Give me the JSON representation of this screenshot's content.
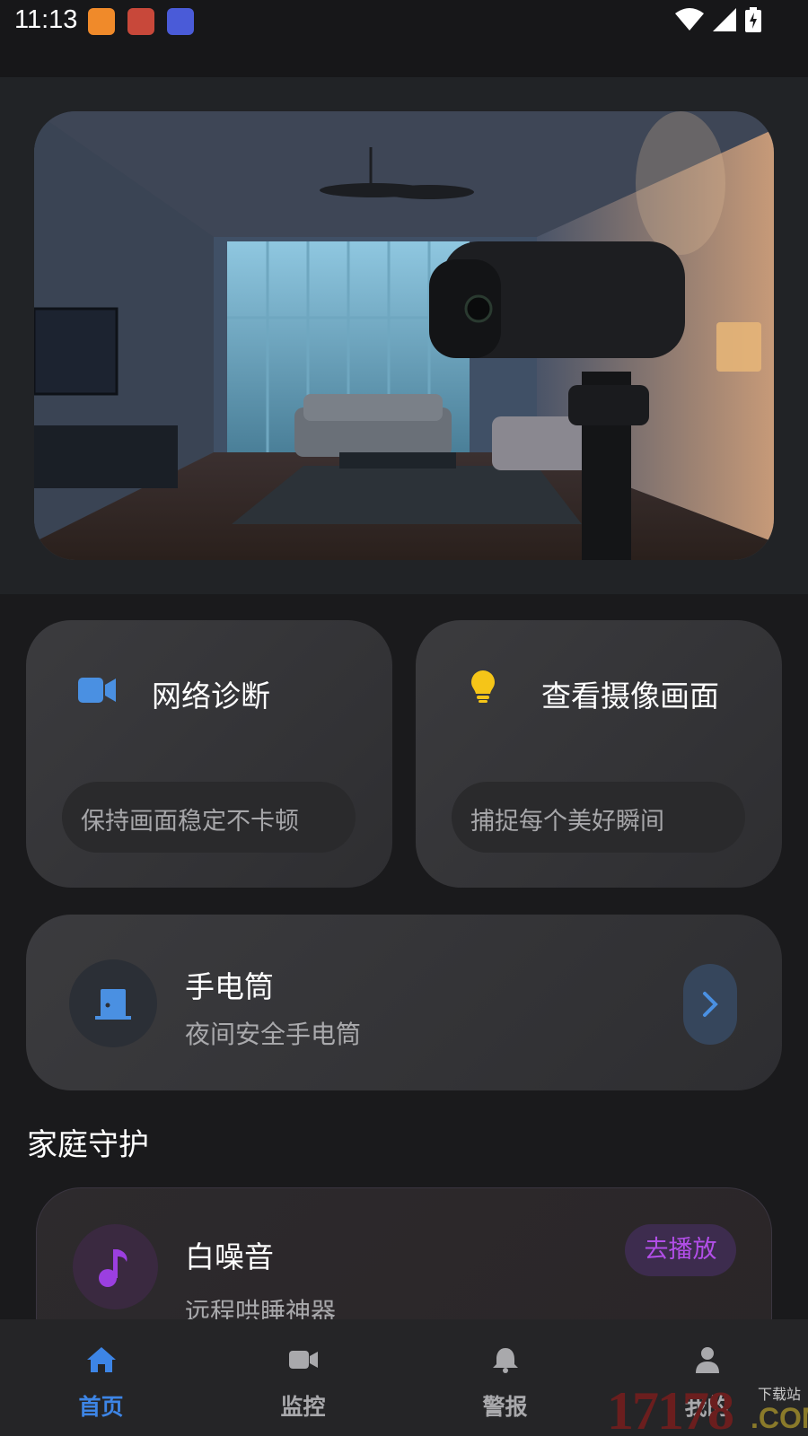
{
  "status_bar": {
    "time": "11:13",
    "icons": [
      "wifi-icon",
      "signal-icon",
      "battery-charging-icon"
    ]
  },
  "hero": {
    "image": "living-room-security-camera-photo"
  },
  "quick_cards": [
    {
      "title": "网络诊断",
      "subtitle": "保持画面稳定不卡顿",
      "icon": "video-camera-icon",
      "icon_color": "#4a90e2"
    },
    {
      "title": "查看摄像画面",
      "subtitle": "捕捉每个美好瞬间",
      "icon": "lightbulb-icon",
      "icon_color": "#f5c518"
    }
  ],
  "flashlight": {
    "title": "手电筒",
    "subtitle": "夜间安全手电筒",
    "icon": "door-icon",
    "icon_color": "#4a90e2"
  },
  "section": {
    "title": "家庭守护"
  },
  "white_noise": {
    "title": "白噪音",
    "subtitle": "远程哄睡神器",
    "button": "去播放",
    "icon": "music-note-icon",
    "icon_color": "#9b3fe0"
  },
  "nav": {
    "items": [
      {
        "label": "首页",
        "icon": "home-icon",
        "active": true
      },
      {
        "label": "监控",
        "icon": "video-camera-icon",
        "active": false
      },
      {
        "label": "警报",
        "icon": "bell-icon",
        "active": false
      },
      {
        "label": "我的",
        "icon": "user-icon",
        "active": false
      }
    ],
    "active_color": "#3d85e6"
  },
  "watermark": {
    "number": "17178",
    "suffix": ".COM",
    "tag": "下载站"
  }
}
